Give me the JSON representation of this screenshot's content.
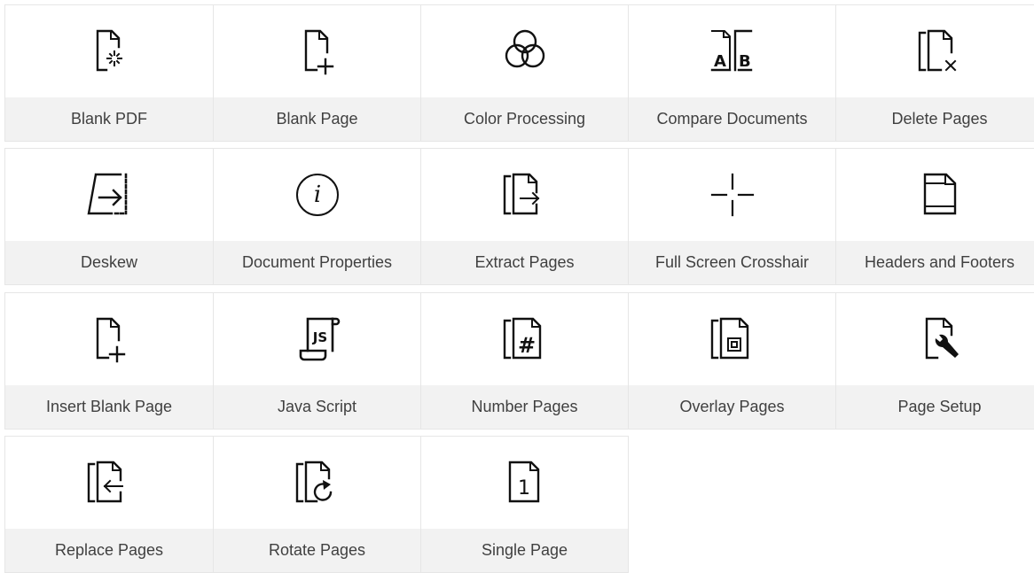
{
  "tools": [
    {
      "label": "Blank PDF",
      "icon": "blank-pdf-icon"
    },
    {
      "label": "Blank Page",
      "icon": "blank-page-icon"
    },
    {
      "label": "Color Processing",
      "icon": "color-processing-icon"
    },
    {
      "label": "Compare Documents",
      "icon": "compare-documents-icon"
    },
    {
      "label": "Delete Pages",
      "icon": "delete-pages-icon"
    },
    {
      "label": "Deskew",
      "icon": "deskew-icon"
    },
    {
      "label": "Document Properties",
      "icon": "document-properties-icon"
    },
    {
      "label": "Extract Pages",
      "icon": "extract-pages-icon"
    },
    {
      "label": "Full Screen Crosshair",
      "icon": "crosshair-icon"
    },
    {
      "label": "Headers and Footers",
      "icon": "headers-footers-icon"
    },
    {
      "label": "Insert Blank Page",
      "icon": "insert-blank-page-icon"
    },
    {
      "label": "Java Script",
      "icon": "javascript-icon"
    },
    {
      "label": "Number Pages",
      "icon": "number-pages-icon"
    },
    {
      "label": "Overlay Pages",
      "icon": "overlay-pages-icon"
    },
    {
      "label": "Page Setup",
      "icon": "page-setup-icon"
    },
    {
      "label": "Replace Pages",
      "icon": "replace-pages-icon"
    },
    {
      "label": "Rotate Pages",
      "icon": "rotate-pages-icon"
    },
    {
      "label": "Single Page",
      "icon": "single-page-icon"
    }
  ],
  "icon_texts": {
    "compare_a": "A",
    "compare_b": "B",
    "info": "i",
    "js": "JS",
    "hash": "#",
    "single": "1"
  },
  "colors": {
    "tile_border": "#e6e6e6",
    "label_background": "#f2f2f2",
    "icon_stroke": "#111111",
    "text": "#404040"
  }
}
